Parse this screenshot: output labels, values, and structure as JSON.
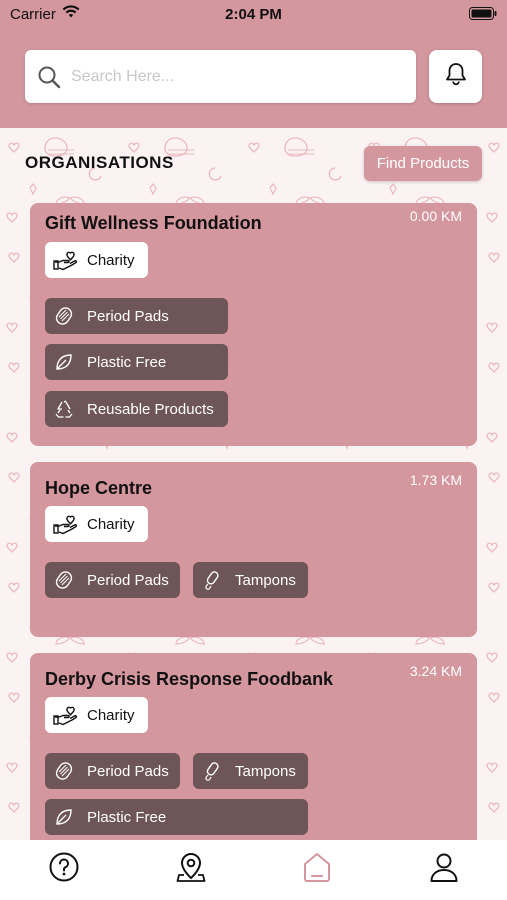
{
  "status": {
    "carrier": "Carrier",
    "time": "2:04 PM"
  },
  "search": {
    "placeholder": "Search Here..."
  },
  "section": {
    "title": "ORGANISATIONS",
    "find_label": "Find Products"
  },
  "orgs": [
    {
      "name": "Gift Wellness Foundation",
      "distance": "0.00 KM",
      "type": "Charity",
      "tags": [
        "Period Pads",
        "Plastic Free",
        "Reusable Products"
      ]
    },
    {
      "name": "Hope Centre",
      "distance": "1.73 KM",
      "type": "Charity",
      "tags": [
        "Period Pads",
        "Tampons"
      ]
    },
    {
      "name": "Derby Crisis Response Foodbank",
      "distance": "3.24 KM",
      "type": "Charity",
      "tags": [
        "Period Pads",
        "Tampons",
        "Plastic Free"
      ]
    }
  ],
  "icons": {
    "search": "search-icon",
    "bell": "bell-icon",
    "charity": "heart-hand-icon",
    "pads": "pad-icon",
    "plastic_free": "leaf-icon",
    "reusable": "recycle-icon",
    "tampons": "tampon-icon",
    "tabs": [
      "help-icon",
      "location-pin-icon",
      "home-icon",
      "profile-icon"
    ]
  },
  "colors": {
    "brand": "#d4979e",
    "tag_bg": "#6e5557",
    "active_tab": "#d4979e"
  }
}
